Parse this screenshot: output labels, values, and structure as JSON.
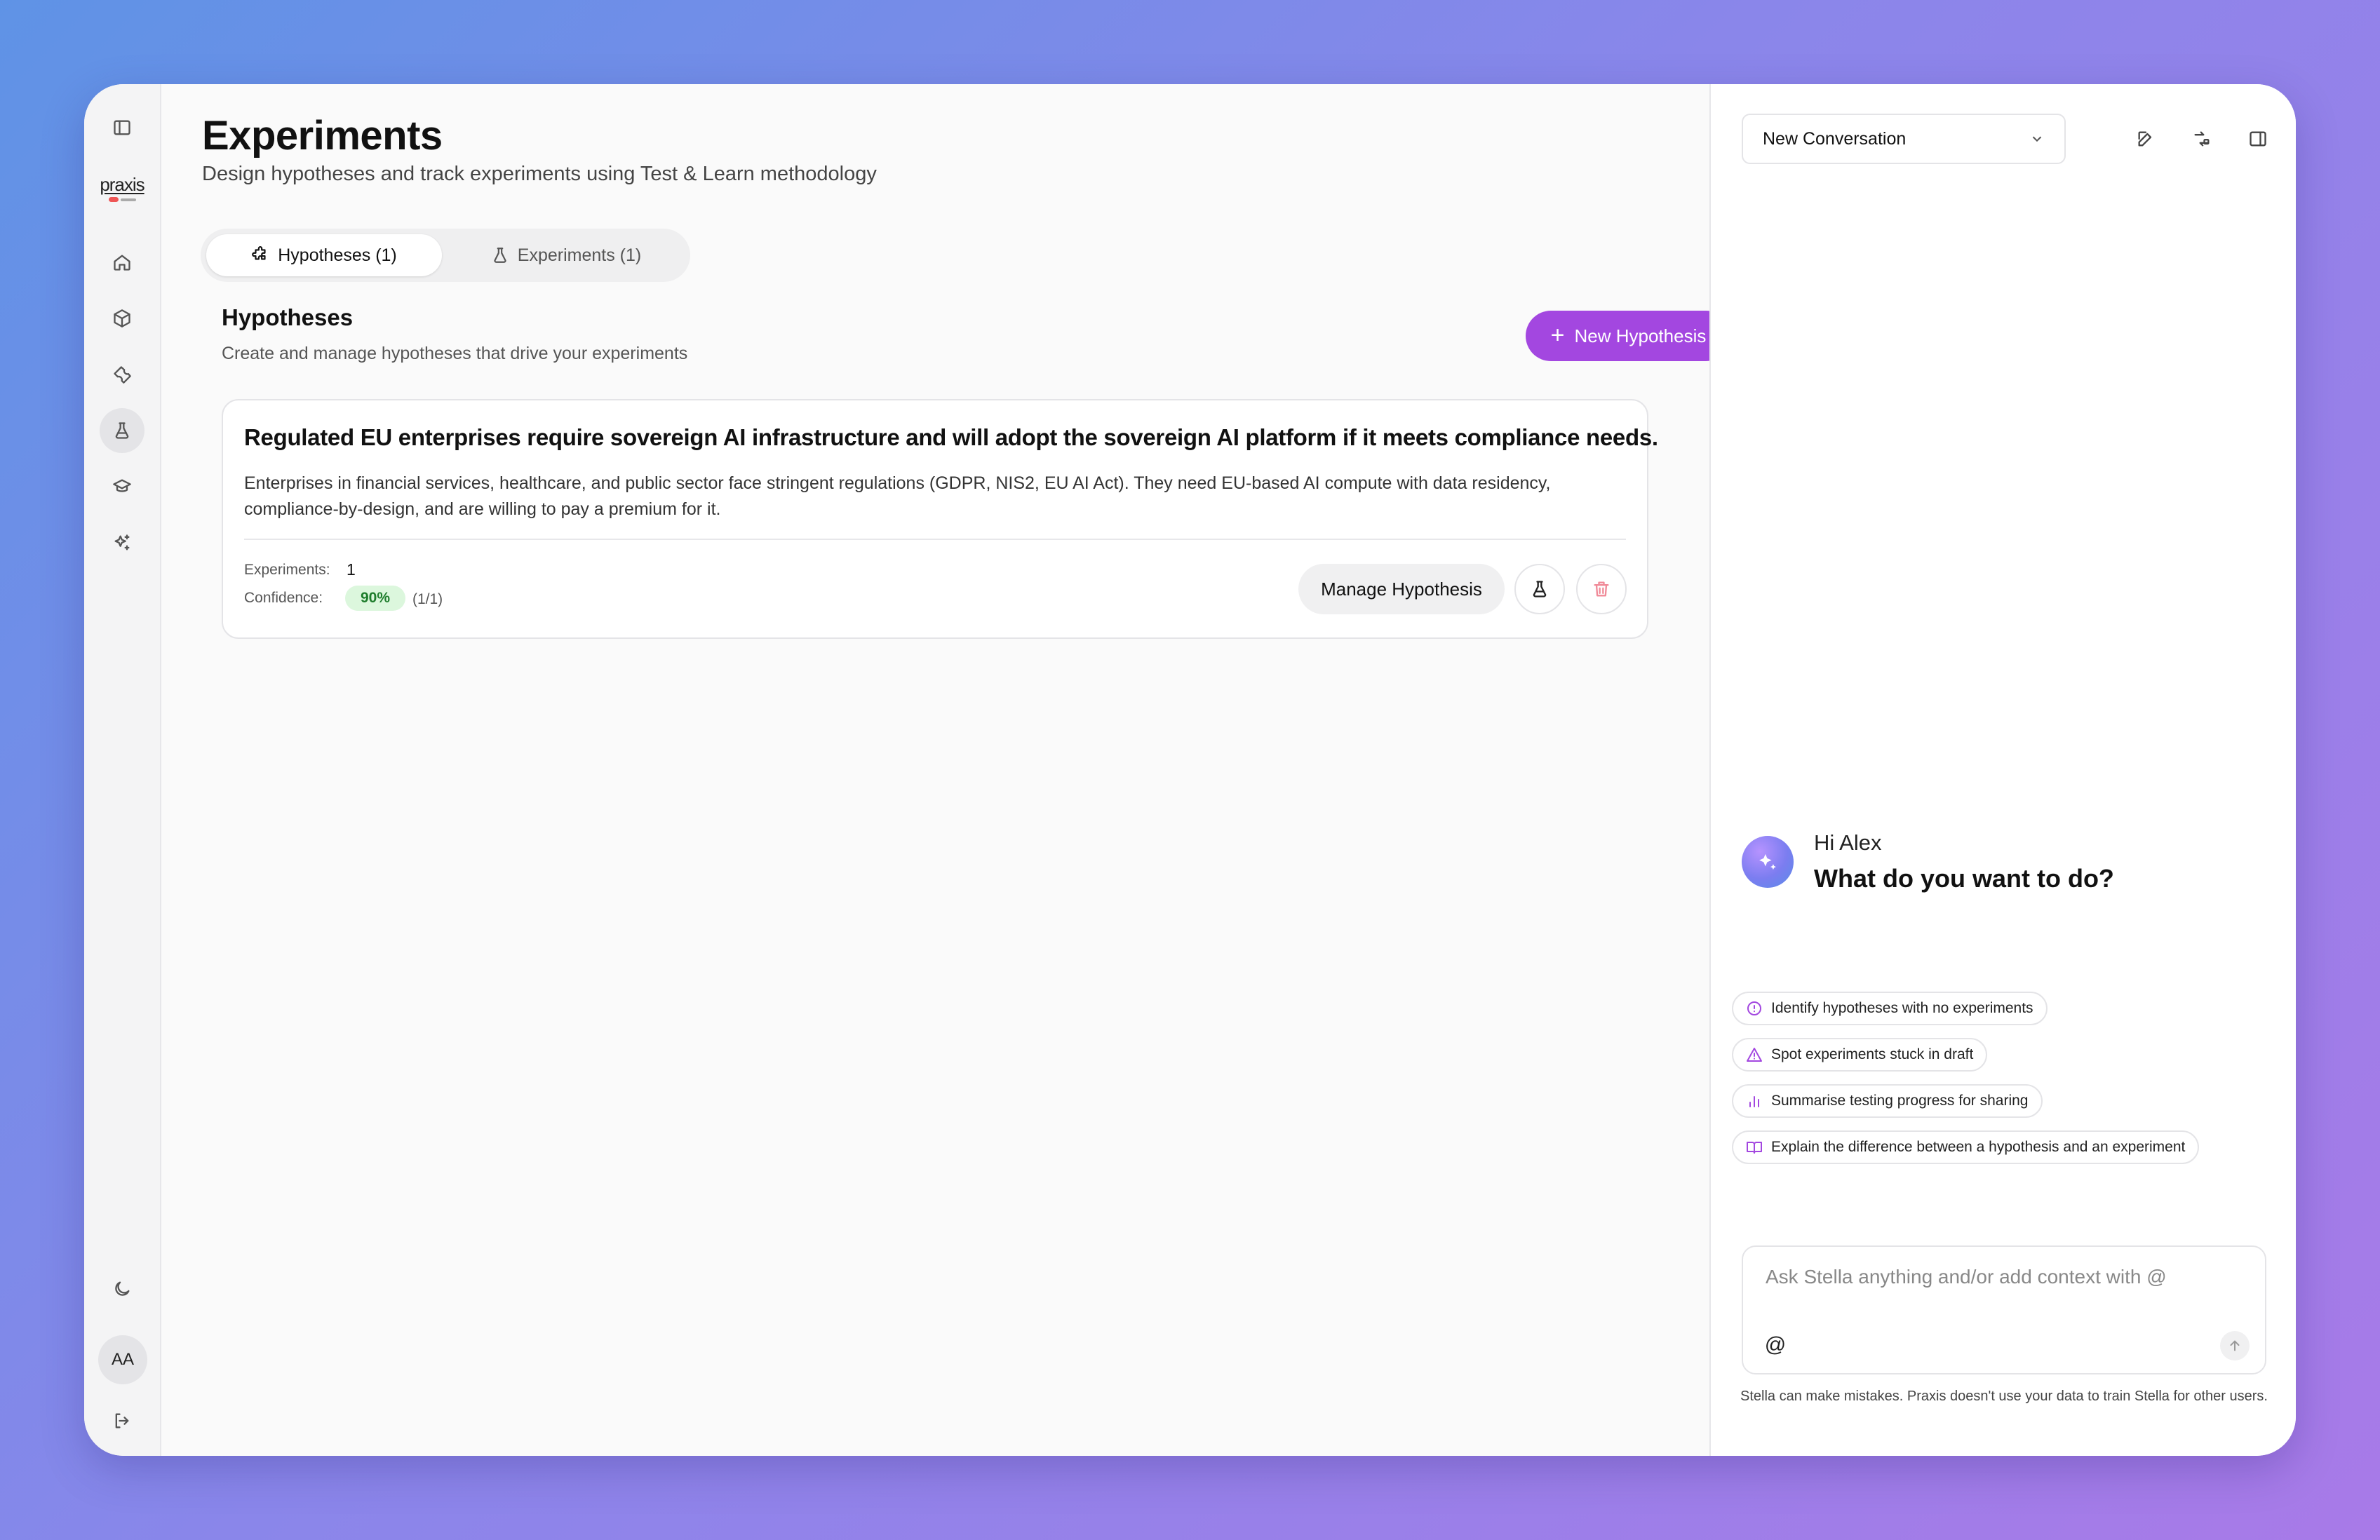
{
  "colors": {
    "accent": "#a347e0",
    "confidence_badge_bg": "#dcf7dd",
    "confidence_badge_text": "#1e7d2c",
    "delete_icon": "#f08a98"
  },
  "sidebar": {
    "logo_text": "praxis",
    "avatar_initials": "AA",
    "items": [
      {
        "name": "home",
        "icon": "home-icon"
      },
      {
        "name": "products",
        "icon": "box-icon"
      },
      {
        "name": "tools",
        "icon": "wrench-icon"
      },
      {
        "name": "experiments",
        "icon": "flask-icon",
        "active": true
      },
      {
        "name": "learning",
        "icon": "graduation-cap-icon"
      },
      {
        "name": "ai",
        "icon": "sparkles-icon"
      }
    ]
  },
  "main": {
    "title": "Experiments",
    "subtitle": "Design hypotheses and track experiments using Test & Learn methodology",
    "tabs": [
      {
        "label": "Hypotheses (1)",
        "icon": "puzzle-icon",
        "active": true
      },
      {
        "label": "Experiments (1)",
        "icon": "flask-icon",
        "active": false
      }
    ],
    "section": {
      "title": "Hypotheses",
      "subtitle": "Create and manage hypotheses that drive your experiments",
      "new_button_label": "New Hypothesis"
    },
    "hypotheses": [
      {
        "title": "Regulated EU enterprises require sovereign AI infrastructure and will adopt the sovereign AI platform if it meets compliance needs.",
        "description": "Enterprises in financial services, healthcare, and public sector face stringent regulations (GDPR, NIS2, EU AI Act). They need EU-based AI compute with data residency, compliance-by-design, and are willing to pay a premium for it.",
        "experiments_label": "Experiments:",
        "experiments_count": "1",
        "confidence_label": "Confidence:",
        "confidence_value": "90%",
        "confidence_ratio": "(1/1)",
        "manage_label": "Manage Hypothesis"
      }
    ]
  },
  "assistant": {
    "conversation_select": "New Conversation",
    "greeting": "Hi Alex",
    "prompt": "What do you want to do?",
    "suggestions": [
      {
        "label": "Identify hypotheses with no experiments",
        "icon": "alert-circle-icon"
      },
      {
        "label": "Spot experiments stuck in draft",
        "icon": "warning-triangle-icon"
      },
      {
        "label": "Summarise testing progress for sharing",
        "icon": "bar-chart-icon"
      },
      {
        "label": "Explain the difference between a hypothesis and an experiment",
        "icon": "book-open-icon"
      }
    ],
    "input_placeholder": "Ask Stella anything and/or add context with @",
    "at_symbol": "@",
    "disclaimer": "Stella can make mistakes. Praxis doesn't use your data to train Stella for other users."
  }
}
